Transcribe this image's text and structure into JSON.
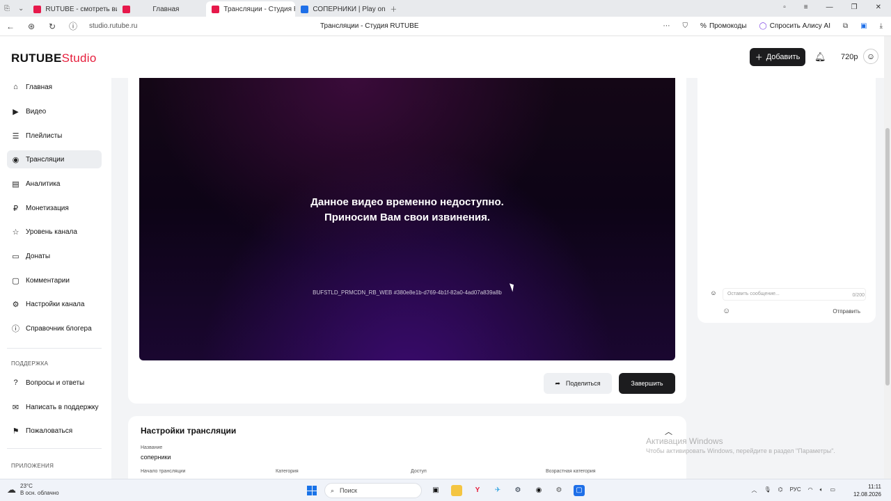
{
  "browser": {
    "tabs": [
      {
        "label": "RUTUBE - смотреть видео",
        "active": false
      },
      {
        "label": "Главная",
        "active": false
      },
      {
        "label": "Трансляции - Студия R",
        "active": true
      },
      {
        "label": "СОПЕРНИКИ | Play on Ru",
        "active": false
      }
    ],
    "url": "studio.rutube.ru",
    "page_title": "Трансляции - Студия RUTUBE",
    "promo_label": "Промокоды",
    "alice_label": "Спросить Алису AI"
  },
  "header": {
    "logo_main": "RUTUBE",
    "logo_studio": "Studio",
    "add_button": "Добавить",
    "quality": "720p"
  },
  "sidebar": {
    "items": [
      {
        "label": "Главная",
        "icon": "home-icon"
      },
      {
        "label": "Видео",
        "icon": "video-icon"
      },
      {
        "label": "Плейлисты",
        "icon": "playlist-icon"
      },
      {
        "label": "Трансляции",
        "icon": "broadcast-icon"
      },
      {
        "label": "Аналитика",
        "icon": "analytics-icon"
      },
      {
        "label": "Монетизация",
        "icon": "coin-icon"
      },
      {
        "label": "Уровень канала",
        "icon": "star-icon"
      },
      {
        "label": "Донаты",
        "icon": "donate-icon"
      },
      {
        "label": "Комментарии",
        "icon": "comment-icon"
      },
      {
        "label": "Настройки канала",
        "icon": "gear-icon"
      },
      {
        "label": "Справочник блогера",
        "icon": "info-icon"
      }
    ],
    "support_heading": "ПОДДЕРЖКА",
    "support_items": [
      {
        "label": "Вопросы и ответы",
        "icon": "question-icon"
      },
      {
        "label": "Написать в поддержку",
        "icon": "mail-icon"
      },
      {
        "label": "Пожаловаться",
        "icon": "flag-icon"
      }
    ],
    "apps_heading": "ПРИЛОЖЕНИЯ"
  },
  "player": {
    "message_line1": "Данное видео временно недоступно.",
    "message_line2": "Приносим Вам свои извинения.",
    "error_code": "BUFSTLD_PRMCDN_RB_WEB #380e8e1b-d769-4b1f-82a0-4ad07a839a8b"
  },
  "actions": {
    "share": "Поделиться",
    "finish": "Завершить"
  },
  "settings": {
    "title": "Настройки трансляции",
    "name_label": "Название",
    "name_value": "соперники",
    "start_label": "Начало трансляции",
    "category_label": "Категория",
    "access_label": "Доступ",
    "age_label": "Возрастная категория"
  },
  "chat": {
    "placeholder": "Оставить сообщение...",
    "counter": "0/200",
    "send": "Отправить"
  },
  "watermark": {
    "line1": "Активация Windows",
    "line2": "Чтобы активировать Windows, перейдите в раздел \"Параметры\"."
  },
  "taskbar": {
    "temperature": "23°C",
    "weather": "В осн. облачно",
    "search": "Поиск",
    "language": "РУС",
    "time": "11:11",
    "date": "12.08.2026"
  }
}
